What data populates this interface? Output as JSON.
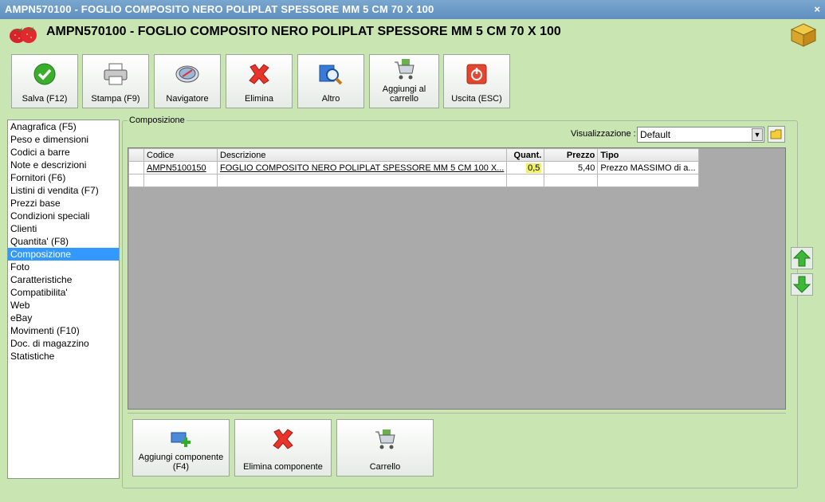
{
  "window": {
    "title": "AMPN570100 - FOGLIO COMPOSITO NERO POLIPLAT SPESSORE MM 5 CM 70 X 100",
    "close_glyph": "×"
  },
  "header": {
    "title": "AMPN570100 - FOGLIO COMPOSITO NERO POLIPLAT SPESSORE MM 5 CM 70 X 100",
    "logo_icon": "strawberry-icon",
    "app_icon": "cube-icon"
  },
  "toolbar": [
    {
      "label": "Salva (F12)",
      "icon": "check-icon"
    },
    {
      "label": "Stampa (F9)",
      "icon": "printer-icon"
    },
    {
      "label": "Navigatore",
      "icon": "compass-icon"
    },
    {
      "label": "Elimina",
      "icon": "delete-x-icon"
    },
    {
      "label": "Altro",
      "icon": "magnifier-icon"
    },
    {
      "label": "Aggiungi al carrello",
      "icon": "cart-add-icon"
    },
    {
      "label": "Uscita (ESC)",
      "icon": "power-icon"
    }
  ],
  "sidebar": {
    "items": [
      "Anagrafica (F5)",
      "Peso e dimensioni",
      "Codici a barre",
      "Note e descrizioni",
      "Fornitori (F6)",
      "Listini di vendita (F7)",
      "Prezzi base",
      "Condizioni speciali",
      "Clienti",
      "Quantita' (F8)",
      "Composizione",
      "Foto",
      "Caratteristiche",
      "Compatibilita'",
      "Web",
      "eBay",
      "Movimenti (F10)",
      "Doc. di magazzino",
      "Statistiche"
    ],
    "selected": "Composizione"
  },
  "composition": {
    "group_title": "Composizione",
    "view_label": "Visualizzazione :",
    "view_value": "Default",
    "columns": [
      "Codice",
      "Descrizione",
      "Quant.",
      "Prezzo",
      "Tipo"
    ],
    "rows": [
      {
        "codice": "AMPN5100150",
        "descrizione": "FOGLIO COMPOSITO NERO POLIPLAT SPESSORE MM 5 CM 100 X...",
        "quant": "0,5",
        "prezzo": "5,40",
        "tipo": "Prezzo MASSIMO di a..."
      }
    ],
    "highlight_color": "#f0f06a"
  },
  "bottom_buttons": [
    {
      "label": "Aggiungi componente (F4)",
      "icon": "add-component-icon"
    },
    {
      "label": "Elimina componente",
      "icon": "delete-x-icon"
    },
    {
      "label": "Carrello",
      "icon": "cart-icon"
    }
  ],
  "colors": {
    "background": "#c9e6b2",
    "selection": "#3399ff",
    "titlebar": "#6f9dcb"
  }
}
